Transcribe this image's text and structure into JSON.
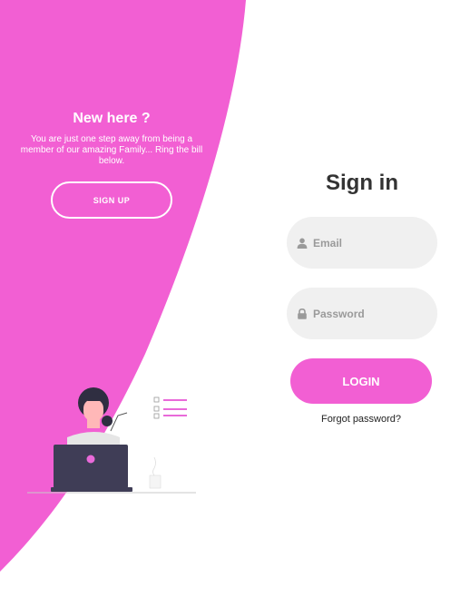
{
  "colors": {
    "accent": "#f25fd3",
    "field_bg": "#f0f0f0",
    "laptop": "#3f3d56",
    "illustration_lines": "#e96ad9"
  },
  "left_panel": {
    "title": "New here ?",
    "description": "You are just one step away from being a member of our amazing Family... Ring the bill below.",
    "signup_label": "SIGN UP",
    "illustration_icon": "woman-at-laptop-illustration"
  },
  "signin": {
    "title": "Sign in",
    "email": {
      "placeholder": "Email",
      "icon": "user-icon"
    },
    "password": {
      "placeholder": "Password",
      "icon": "lock-icon"
    },
    "login_label": "LOGIN",
    "forgot_label": "Forgot password?"
  }
}
